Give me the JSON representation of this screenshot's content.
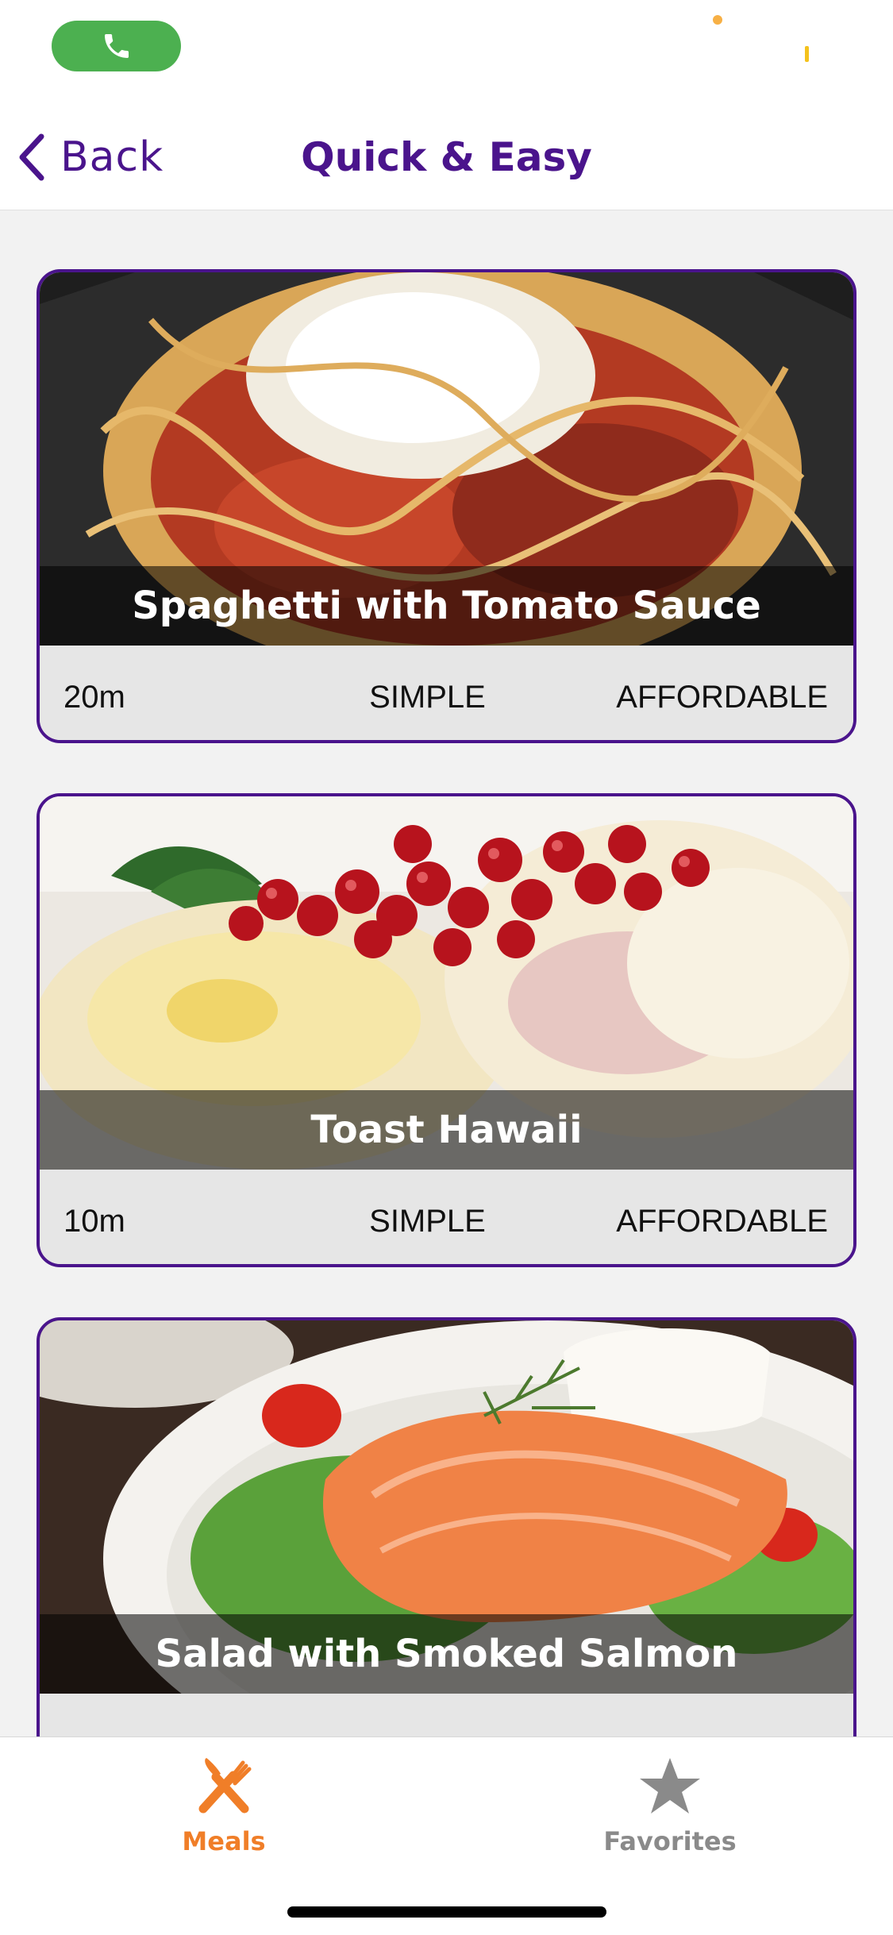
{
  "colors": {
    "brand_purple": "#4a148c",
    "accent_orange": "#f07e28",
    "inactive_gray": "#8a8a8a",
    "call_green": "#4cb050"
  },
  "status_bar": {
    "call_icon": "phone-icon"
  },
  "header": {
    "back_label": "Back",
    "back_icon": "chevron-left-icon",
    "title": "Quick & Easy"
  },
  "meals": [
    {
      "title": "Spaghetti with Tomato Sauce",
      "duration": "20m",
      "complexity": "SIMPLE",
      "affordability": "AFFORDABLE"
    },
    {
      "title": "Toast Hawaii",
      "duration": "10m",
      "complexity": "SIMPLE",
      "affordability": "AFFORDABLE"
    },
    {
      "title": "Salad with Smoked Salmon"
    }
  ],
  "tabs": [
    {
      "label": "Meals",
      "icon": "fork-knife-icon",
      "active": true
    },
    {
      "label": "Favorites",
      "icon": "star-icon",
      "active": false
    }
  ]
}
